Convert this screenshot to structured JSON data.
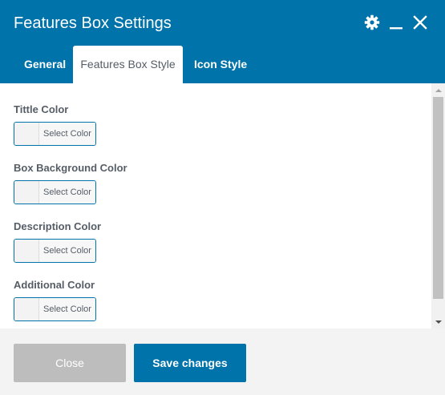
{
  "dialog": {
    "title": "Features Box Settings",
    "header_icons": [
      "gear-icon",
      "minimize-icon",
      "close-icon"
    ]
  },
  "tabs": [
    {
      "label": "General",
      "active": false
    },
    {
      "label": "Features Box Style",
      "active": true
    },
    {
      "label": "Icon Style",
      "active": false
    }
  ],
  "fields": [
    {
      "label": "Tittle Color",
      "button": "Select Color"
    },
    {
      "label": "Box Background Color",
      "button": "Select Color"
    },
    {
      "label": "Description Color",
      "button": "Select Color"
    },
    {
      "label": "Additional Color",
      "button": "Select Color"
    }
  ],
  "footer": {
    "close_label": "Close",
    "save_label": "Save changes"
  },
  "colors": {
    "accent": "#0073aa",
    "disabled_button": "#bdbdbd",
    "footer_bg": "#f3f3f3"
  }
}
